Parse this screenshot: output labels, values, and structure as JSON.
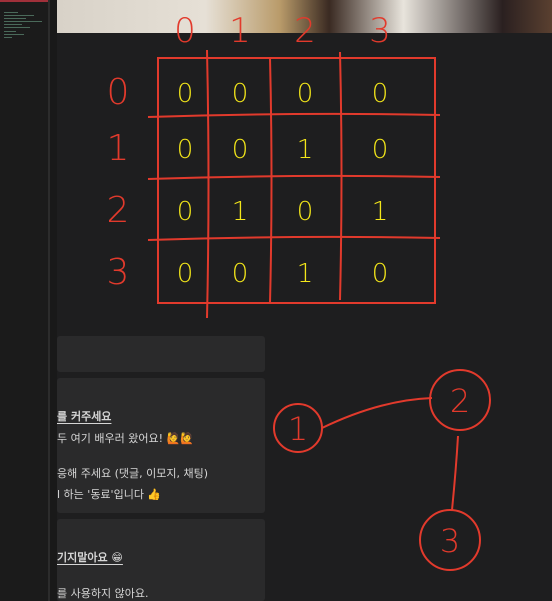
{
  "colors": {
    "ink_red": "#e23a2c",
    "ink_yellow": "#f3e61a",
    "background": "#1e1e1f",
    "card": "#2a2a2b"
  },
  "cards": [
    {
      "lines": []
    },
    {
      "heading": "를 커주세요",
      "lines": [
        "두 여기 배우러 왔어요! 🙋🙋",
        "",
        "응해 주세요 (댓글, 이모지, 채팅)",
        "l 하는 '동료'입니다 👍"
      ]
    },
    {
      "heading": "기지말아요 😁",
      "lines": [
        "",
        "를 사용하지 않아요."
      ]
    }
  ],
  "annotation": {
    "column_labels": [
      "0",
      "1",
      "2",
      "3"
    ],
    "row_labels": [
      "0",
      "1",
      "2",
      "3"
    ],
    "matrix": [
      [
        "0",
        "0",
        "0",
        "0"
      ],
      [
        "0",
        "0",
        "1",
        "0"
      ],
      [
        "0",
        "1",
        "0",
        "1"
      ],
      [
        "0",
        "0",
        "1",
        "0"
      ]
    ],
    "graph": {
      "nodes": [
        "1",
        "2",
        "3"
      ],
      "edges": [
        [
          "1",
          "2"
        ],
        [
          "2",
          "3"
        ]
      ]
    }
  }
}
